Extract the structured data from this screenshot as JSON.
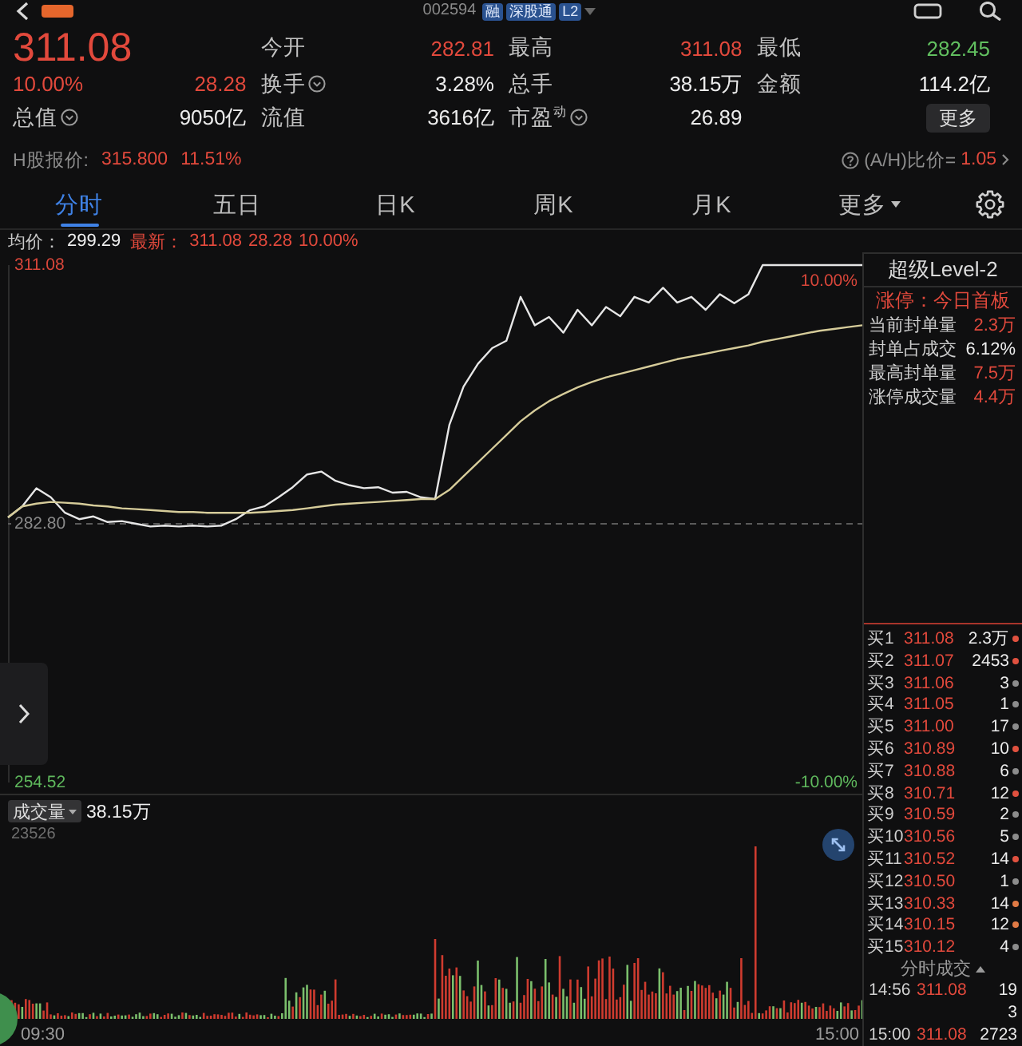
{
  "top_bar": {
    "code": "002594",
    "tags": [
      "融",
      "深股通",
      "L2"
    ]
  },
  "quote": {
    "price": "311.08",
    "change_pct": "10.00%",
    "change": "28.28"
  },
  "stats": [
    {
      "label": "今开",
      "value": "282.81",
      "color": "#e2493c",
      "info": false
    },
    {
      "label": "最高",
      "value": "311.08",
      "color": "#e2493c",
      "info": false
    },
    {
      "label": "最低",
      "value": "282.45",
      "color": "#62c060",
      "info": false
    },
    {
      "label": "换手",
      "value": "3.28%",
      "color": "#ececec",
      "info": true
    },
    {
      "label": "总手",
      "value": "38.15万",
      "color": "#ececec",
      "info": false
    },
    {
      "label": "金额",
      "value": "114.2亿",
      "color": "#ececec",
      "info": false
    },
    {
      "label": "总值",
      "value": "9050亿",
      "color": "#ececec",
      "info": true
    },
    {
      "label": "流值",
      "value": "3616亿",
      "color": "#ececec",
      "info": false
    },
    {
      "label": "市盈$^{动}$",
      "value": "26.89",
      "color": "#ececec",
      "info": true
    }
  ],
  "more_button": "更多",
  "h_share": {
    "label": "H股报价:",
    "price": "315.800",
    "premium": "11.51%",
    "ratio_label": "(A/H)比价=",
    "ratio": "1.05"
  },
  "tabs": [
    {
      "label": "分时",
      "selected": true,
      "dropdown": false
    },
    {
      "label": "五日",
      "selected": false,
      "dropdown": false
    },
    {
      "label": "日K",
      "selected": false,
      "dropdown": false
    },
    {
      "label": "周K",
      "selected": false,
      "dropdown": false
    },
    {
      "label": "月K",
      "selected": false,
      "dropdown": false
    },
    {
      "label": "更多",
      "selected": false,
      "dropdown": true
    }
  ],
  "price_chart": {
    "legend": {
      "avg_label": "均价：",
      "avg_value": "299.29",
      "last_label": "最新：",
      "last_value": "311.08",
      "change": "28.28",
      "change_pct": "10.00%"
    },
    "change_axis": [
      "10.00%",
      "-10.00%"
    ],
    "chart_data": {
      "type": "line",
      "ylim": [
        254.52,
        311.08
      ],
      "yticks": [
        {
          "value": 311.08,
          "label": "311.08"
        },
        {
          "value": 282.8,
          "label": "282.80"
        },
        {
          "value": 254.52,
          "label": "254.52"
        }
      ],
      "series": [
        {
          "color": "#e6e6e6",
          "values": [
            283.5,
            284.7,
            286.7,
            285.7,
            284.0,
            283.3,
            283.6,
            283.0,
            283.1,
            282.8,
            282.5,
            282.6,
            282.5,
            282.6,
            282.5,
            282.6,
            283.3,
            284.3,
            284.7,
            285.7,
            286.8,
            288.2,
            288.5,
            287.5,
            287.0,
            286.7,
            286.8,
            286.2,
            286.3,
            285.7,
            285.5,
            293.6,
            297.8,
            300.3,
            302.0,
            302.8,
            307.6,
            304.5,
            305.4,
            303.7,
            306.2,
            304.5,
            306.5,
            305.5,
            307.6,
            307.0,
            308.6,
            307.0,
            307.6,
            306.2,
            307.9,
            306.9,
            307.9,
            311.08,
            311.08,
            311.08,
            311.08,
            311.08,
            311.08,
            311.08,
            311.08
          ]
        },
        {
          "color": "#d6cc9a",
          "values": [
            283.5,
            284.7,
            285.0,
            285.2,
            285.1,
            285.0,
            284.8,
            284.7,
            284.5,
            284.4,
            284.3,
            284.2,
            284.1,
            284.1,
            284.0,
            284.0,
            284.0,
            284.0,
            284.1,
            284.2,
            284.3,
            284.5,
            284.7,
            284.9,
            285.0,
            285.1,
            285.2,
            285.3,
            285.4,
            285.5,
            285.5,
            286.5,
            288.0,
            289.5,
            291.0,
            292.5,
            294.0,
            295.2,
            296.2,
            297.0,
            297.7,
            298.3,
            298.8,
            299.2,
            299.6,
            300.0,
            300.4,
            300.8,
            301.1,
            301.4,
            301.7,
            302.0,
            302.3,
            302.7,
            303.0,
            303.3,
            303.6,
            303.9,
            304.1,
            304.3,
            304.5
          ]
        }
      ]
    }
  },
  "volume_chart": {
    "selector": "成交量",
    "total": "38.15万",
    "max_label": "23526",
    "start_time": "09:30",
    "end_time": "15:00"
  },
  "level2": {
    "title": "超级Level-2",
    "status": "涨停：今日首板",
    "metrics": [
      {
        "label": "当前封单量",
        "value": "2.3万",
        "kind": "volume"
      },
      {
        "label": "封单占成交",
        "value": "6.12%",
        "kind": "ratio"
      },
      {
        "label": "最高封单量",
        "value": "7.5万",
        "kind": "volume"
      },
      {
        "label": "涨停成交量",
        "value": "4.4万",
        "kind": "volume"
      }
    ]
  },
  "order_book": {
    "bids": [
      {
        "label": "买1",
        "price": "311.08",
        "volume": "2.3万",
        "color": "#e0513f"
      },
      {
        "label": "买2",
        "price": "311.07",
        "volume": "2453",
        "color": "#e0513f"
      },
      {
        "label": "买3",
        "price": "311.06",
        "volume": "3",
        "color": "#8c8c8c"
      },
      {
        "label": "买4",
        "price": "311.05",
        "volume": "1",
        "color": "#8c8c8c"
      },
      {
        "label": "买5",
        "price": "311.00",
        "volume": "17",
        "color": "#8c8c8c"
      },
      {
        "label": "买6",
        "price": "310.89",
        "volume": "10",
        "color": "#e0513f"
      },
      {
        "label": "买7",
        "price": "310.88",
        "volume": "6",
        "color": "#8c8c8c"
      },
      {
        "label": "买8",
        "price": "310.71",
        "volume": "12",
        "color": "#e0513f"
      },
      {
        "label": "买9",
        "price": "310.59",
        "volume": "2",
        "color": "#8c8c8c"
      },
      {
        "label": "买10",
        "price": "310.56",
        "volume": "5",
        "color": "#8c8c8c"
      },
      {
        "label": "买11",
        "price": "310.52",
        "volume": "14",
        "color": "#e0513f"
      },
      {
        "label": "买12",
        "price": "310.50",
        "volume": "1",
        "color": "#8c8c8c"
      },
      {
        "label": "买13",
        "price": "310.33",
        "volume": "14",
        "color": "#e07a45"
      },
      {
        "label": "买14",
        "price": "310.15",
        "volume": "12",
        "color": "#e07a45"
      },
      {
        "label": "买15",
        "price": "310.12",
        "volume": "4",
        "color": "#8c8c8c"
      }
    ]
  },
  "trades": {
    "title": "分时成交",
    "rows": [
      {
        "time": "14:56",
        "price": "311.08",
        "volume": "19"
      },
      {
        "volume": "3"
      },
      {
        "time": "15:00",
        "price": "311.08",
        "volume": "2723"
      }
    ]
  }
}
